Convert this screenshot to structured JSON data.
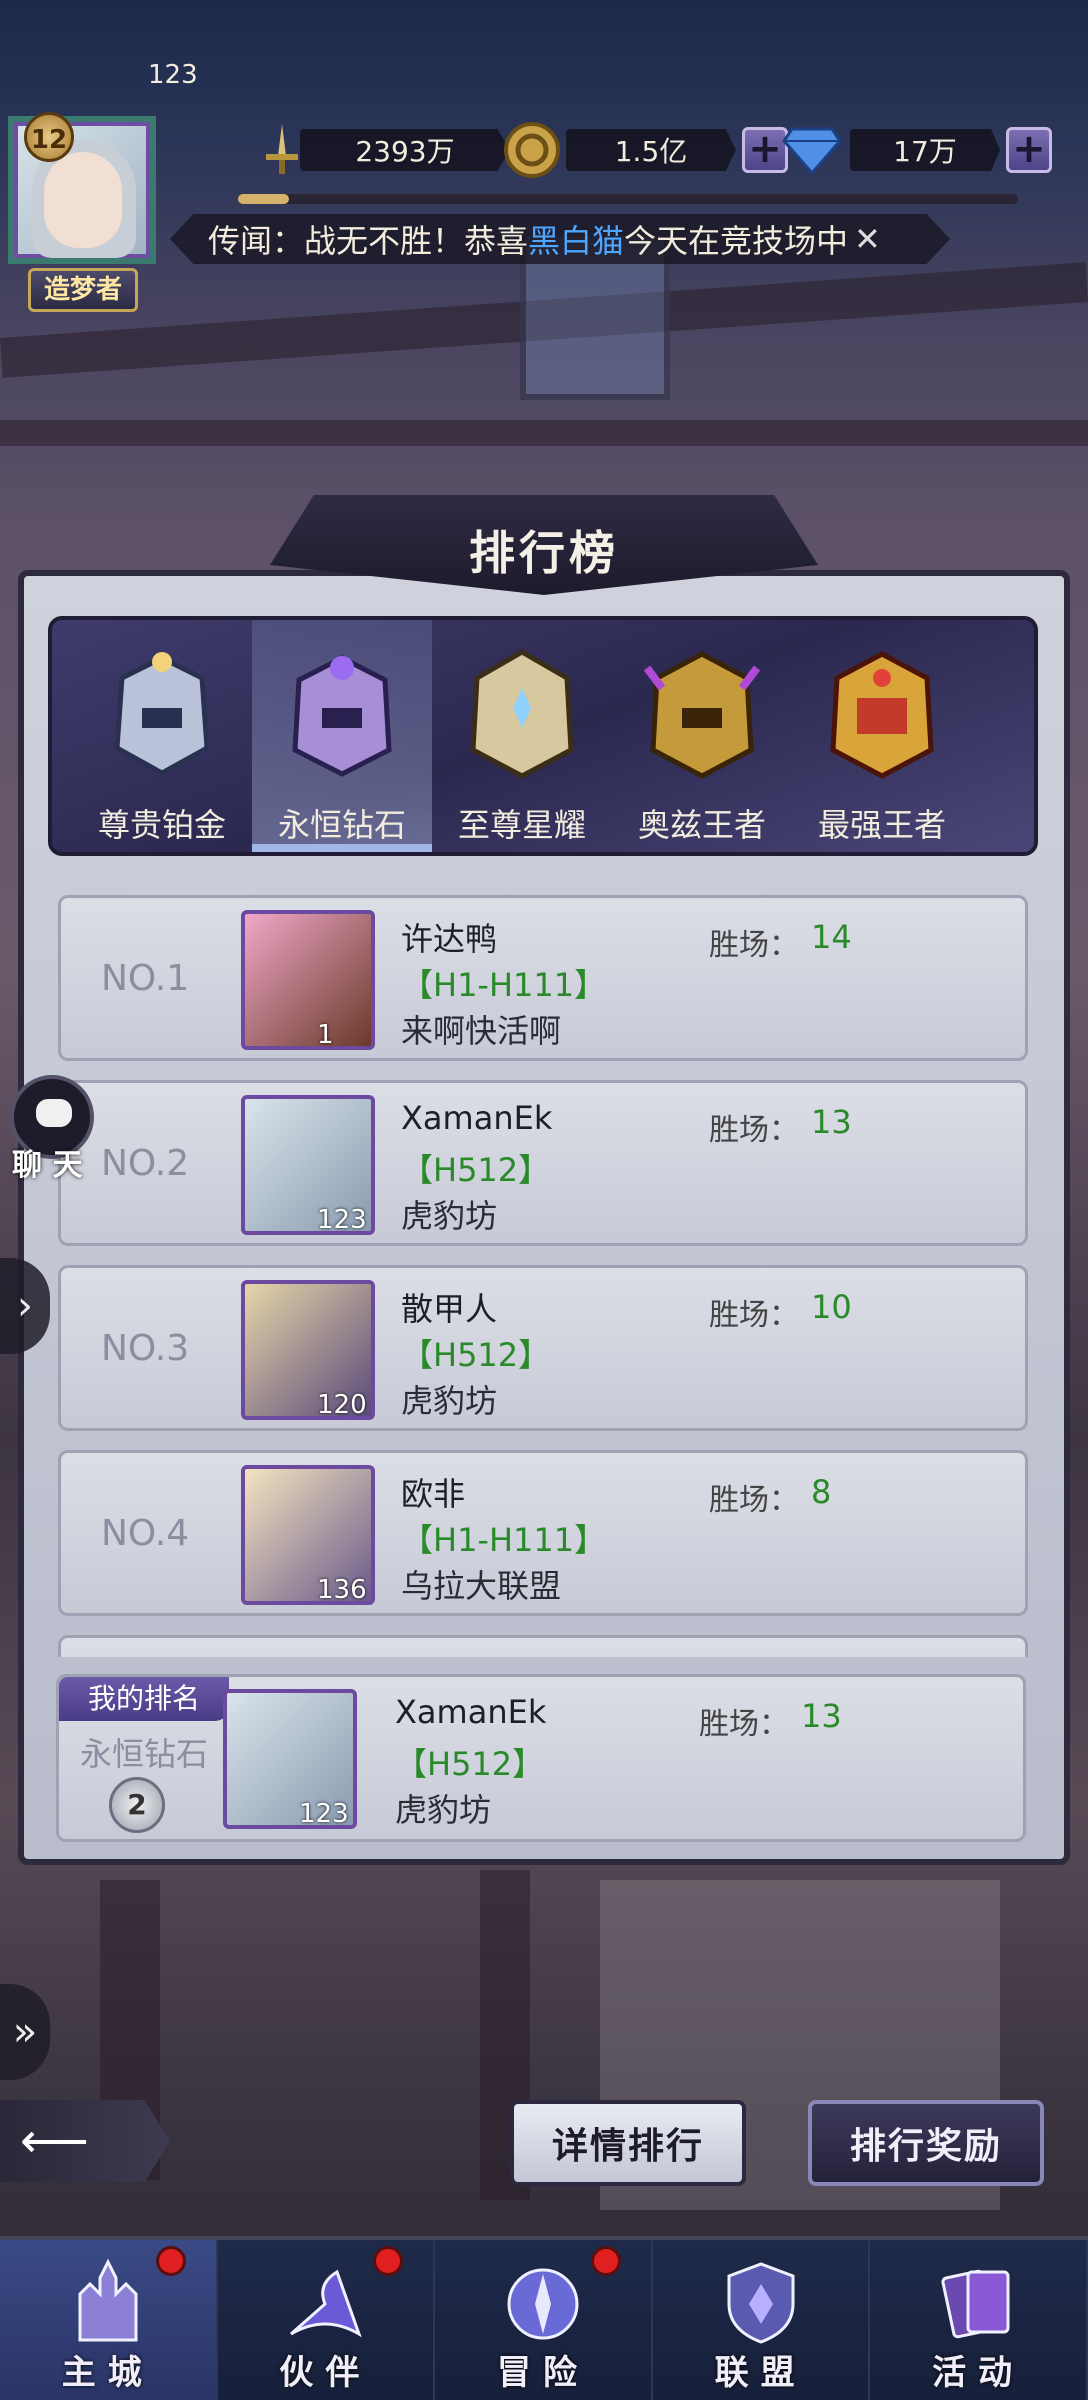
{
  "player": {
    "level": "12",
    "number": "123",
    "title": "造梦者",
    "exp_fraction": 0.066
  },
  "resources": {
    "power": "2393万",
    "gold": "1.5亿",
    "gems": "17万"
  },
  "announcement": {
    "prefix": "传闻：战无不胜！恭喜",
    "highlight": "黑白猫",
    "suffix": "今天在竞技场中"
  },
  "panel": {
    "title": "排行榜"
  },
  "tiers": [
    {
      "label": "尊贵铂金"
    },
    {
      "label": "永恒钻石"
    },
    {
      "label": "至尊星耀"
    },
    {
      "label": "奥兹王者"
    },
    {
      "label": "最强王者"
    }
  ],
  "active_tier_index": 1,
  "wins_label": "胜场：",
  "rankings": [
    {
      "rank": "NO.1",
      "name": "许达鸭",
      "server": "【H1-H111】",
      "guild": "来啊快活啊",
      "wins": "14",
      "level": "1"
    },
    {
      "rank": "NO.2",
      "name": "XamanEk",
      "server": "【H512】",
      "guild": "虎豹坊",
      "wins": "13",
      "level": "123"
    },
    {
      "rank": "NO.3",
      "name": "散甲人",
      "server": "【H512】",
      "guild": "虎豹坊",
      "wins": "10",
      "level": "120"
    },
    {
      "rank": "NO.4",
      "name": "欧非",
      "server": "【H1-H111】",
      "guild": "乌拉大联盟",
      "wins": "8",
      "level": "136"
    }
  ],
  "my_rank": {
    "tag": "我的排名",
    "tier": "永恒钻石",
    "medal": "2",
    "name": "XamanEk",
    "server": "【H512】",
    "guild": "虎豹坊",
    "wins": "13",
    "level": "123"
  },
  "side": {
    "chat_label": "聊 天"
  },
  "buttons": {
    "detail": "详情排行",
    "reward": "排行奖励"
  },
  "nav": [
    {
      "label": "主城",
      "badge": true
    },
    {
      "label": "伙伴",
      "badge": true
    },
    {
      "label": "冒险",
      "badge": true
    },
    {
      "label": "联盟",
      "badge": false
    },
    {
      "label": "活动",
      "badge": false
    }
  ],
  "colors": {
    "server_green": "#2a8a2a",
    "highlight_blue": "#4da6ff",
    "notification_red": "#e02020"
  }
}
